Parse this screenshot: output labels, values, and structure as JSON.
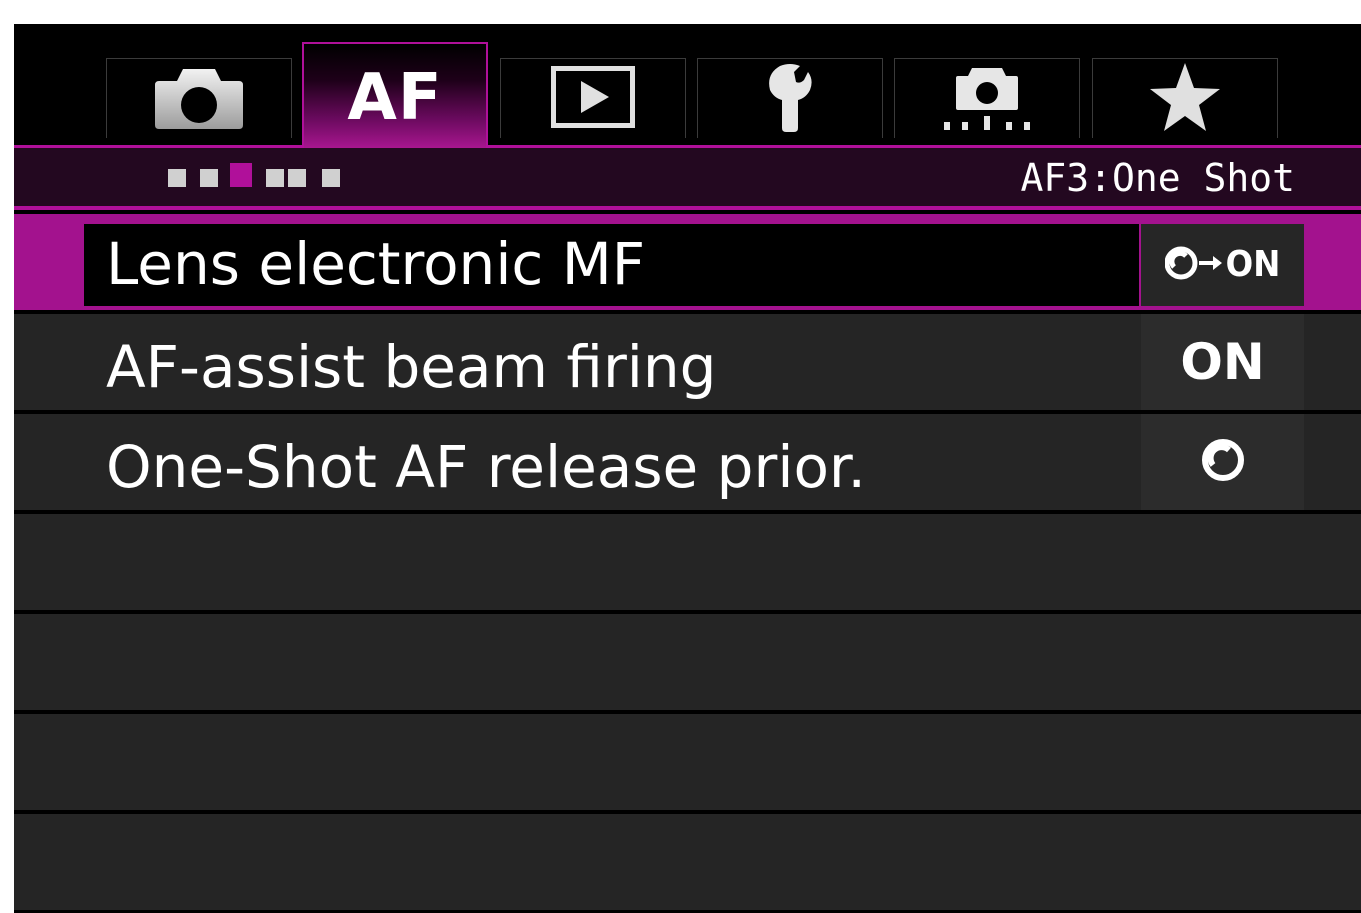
{
  "tabs": [
    {
      "icon": "camera-icon",
      "label": "",
      "active": false
    },
    {
      "icon": "af-icon",
      "label": "AF",
      "active": true
    },
    {
      "icon": "playback-icon",
      "label": "",
      "active": false
    },
    {
      "icon": "wrench-icon",
      "label": "",
      "active": false
    },
    {
      "icon": "custom-functions-icon",
      "label": "",
      "active": false
    },
    {
      "icon": "star-icon",
      "label": "",
      "active": false
    }
  ],
  "page_indicator": {
    "count": 6,
    "current": 3
  },
  "page_title": "AF3:One Shot",
  "menu_items": [
    {
      "label": "Lens electronic MF",
      "value_icon": "focus-arrow-icon",
      "value_text": "ON",
      "selected": true
    },
    {
      "label": "AF-assist beam firing",
      "value_text": "ON",
      "selected": false
    },
    {
      "label": "One-Shot AF release prior.",
      "value_icon": "focus-priority-icon",
      "value_text": "",
      "selected": false
    }
  ],
  "colors": {
    "accent": "#a3128e",
    "background": "#000000",
    "row": "#252525"
  }
}
